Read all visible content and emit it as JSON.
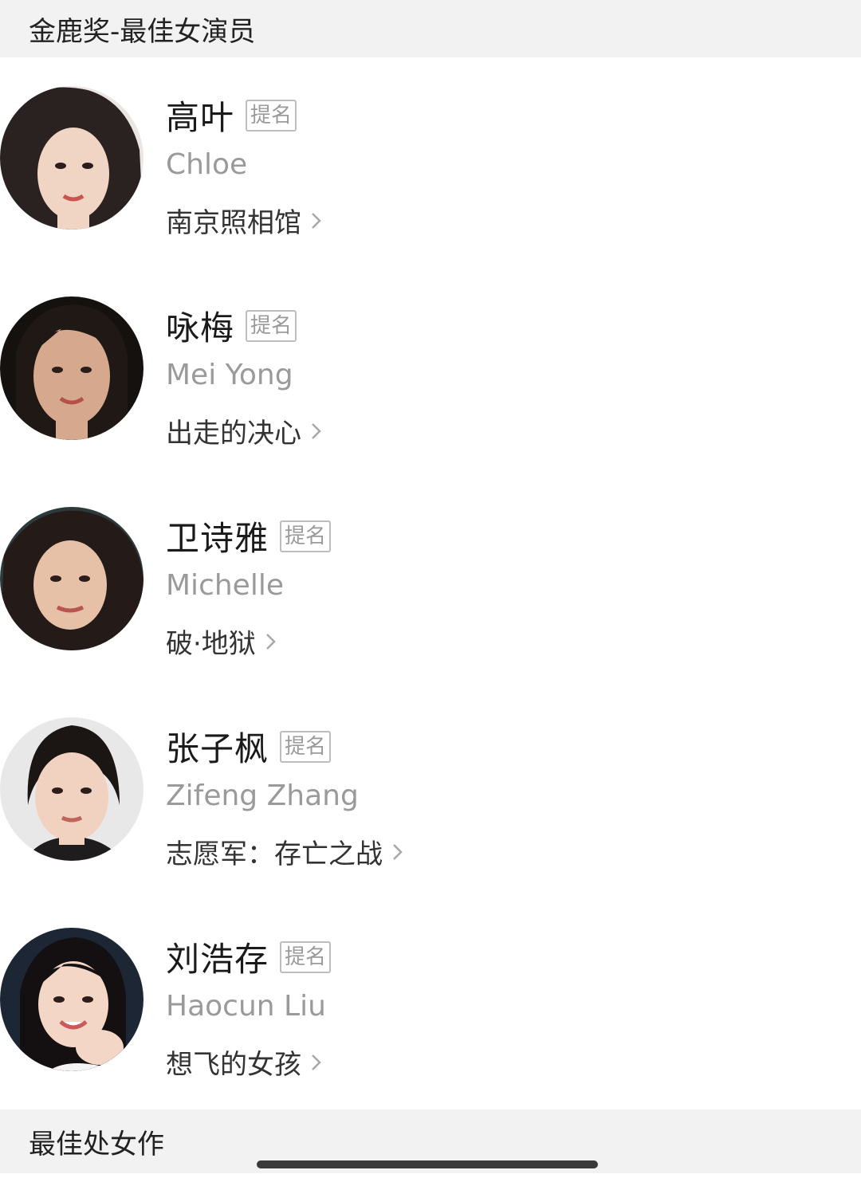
{
  "header_title": "金鹿奖-最佳女演员",
  "nominee_tag": "提名",
  "nominees": [
    {
      "name": "高叶",
      "name_en": "Chloe",
      "film": "南京照相馆"
    },
    {
      "name": "咏梅",
      "name_en": "Mei Yong",
      "film": "出走的决心"
    },
    {
      "name": "卫诗雅",
      "name_en": "Michelle",
      "film": "破·地狱"
    },
    {
      "name": "张子枫",
      "name_en": "Zifeng Zhang",
      "film": "志愿军：存亡之战"
    },
    {
      "name": "刘浩存",
      "name_en": "Haocun Liu",
      "film": "想飞的女孩"
    }
  ],
  "next_section_title": "最佳处女作",
  "colors": {
    "header_bg": "#f2f2f2",
    "tag_border": "#bdbdbd",
    "secondary_text": "#9a9a9a"
  }
}
